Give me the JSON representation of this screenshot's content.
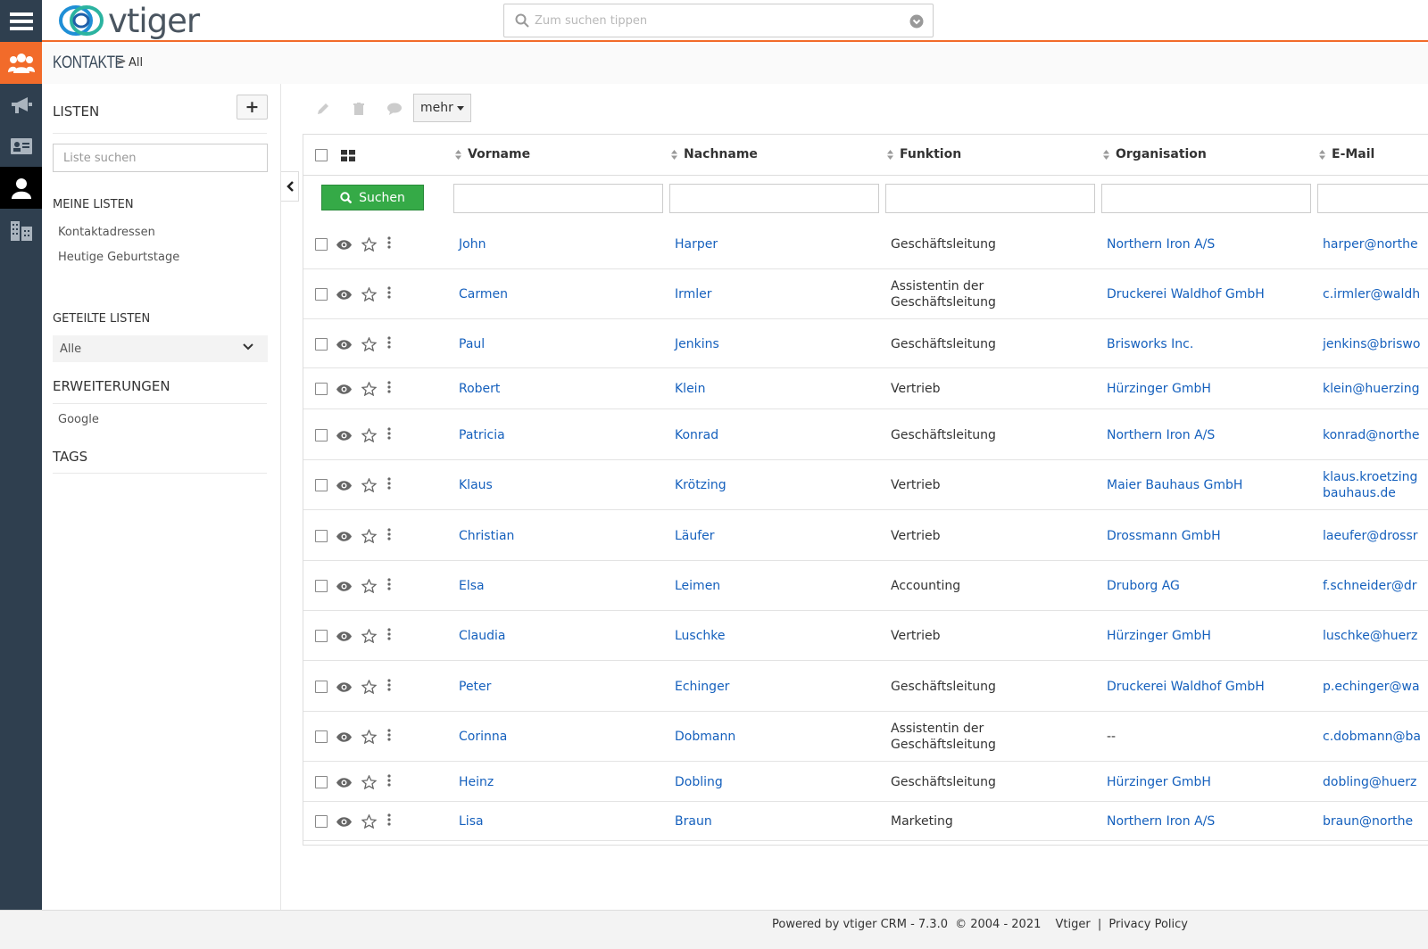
{
  "search": {
    "placeholder": "Zum suchen tippen"
  },
  "logo": {
    "text": "vtiger"
  },
  "breadcrumb": {
    "module": "KONTAKTE",
    "separator": ">",
    "view": "All"
  },
  "sidebar": {
    "lists_heading": "LISTEN",
    "add_label": "+",
    "list_search_placeholder": "Liste suchen",
    "my_lists_heading": "MEINE LISTEN",
    "my_lists": [
      "Kontaktadressen",
      "Heutige Geburtstage"
    ],
    "shared_lists_heading": "GETEILTE LISTEN",
    "shared_selected": "Alle",
    "extensions_heading": "ERWEITERUNGEN",
    "extensions": [
      "Google"
    ],
    "tags_heading": "TAGS"
  },
  "toolbar": {
    "more_label": "mehr"
  },
  "table": {
    "search_button": "Suchen",
    "columns": [
      "Vorname",
      "Nachname",
      "Funktion",
      "Organisation",
      "E-Mail"
    ],
    "rows": [
      {
        "first": "John",
        "last": "Harper",
        "func": [
          "Geschäftsleitung"
        ],
        "org": "Northern Iron A/S",
        "email": [
          "harper@northe"
        ]
      },
      {
        "first": "Carmen",
        "last": "Irmler",
        "func": [
          "Assistentin der",
          "Geschäftsleitung"
        ],
        "org": "Druckerei Waldhof GmbH",
        "email": [
          "c.irmler@waldh"
        ]
      },
      {
        "first": "Paul",
        "last": "Jenkins",
        "func": [
          "Geschäftsleitung"
        ],
        "org": "Brisworks Inc.",
        "email": [
          "jenkins@briswo"
        ]
      },
      {
        "first": "Robert",
        "last": "Klein",
        "func": [
          "Vertrieb"
        ],
        "org": "Hürzinger GmbH",
        "email": [
          "klein@huerzing"
        ]
      },
      {
        "first": "Patricia",
        "last": "Konrad",
        "func": [
          "Geschäftsleitung"
        ],
        "org": "Northern Iron A/S",
        "email": [
          "konrad@northe"
        ]
      },
      {
        "first": "Klaus",
        "last": "Krötzing",
        "func": [
          "Vertrieb"
        ],
        "org": "Maier Bauhaus GmbH",
        "email": [
          "klaus.kroetzing",
          "bauhaus.de"
        ]
      },
      {
        "first": "Christian",
        "last": "Läufer",
        "func": [
          "Vertrieb"
        ],
        "org": "Drossmann GmbH",
        "email": [
          "laeufer@drossr"
        ]
      },
      {
        "first": "Elsa",
        "last": "Leimen",
        "func": [
          "Accounting"
        ],
        "org": "Druborg AG",
        "email": [
          "f.schneider@dr"
        ]
      },
      {
        "first": "Claudia",
        "last": "Luschke",
        "func": [
          "Vertrieb"
        ],
        "org": "Hürzinger GmbH",
        "email": [
          "luschke@huerz"
        ]
      },
      {
        "first": "Peter",
        "last": "Echinger",
        "func": [
          "Geschäftsleitung"
        ],
        "org": "Druckerei Waldhof GmbH",
        "email": [
          "p.echinger@wa"
        ]
      },
      {
        "first": "Corinna",
        "last": "Dobmann",
        "func": [
          "Assistentin der",
          "Geschäftsleitung"
        ],
        "org": "--",
        "email": [
          "c.dobmann@ba"
        ]
      },
      {
        "first": "Heinz",
        "last": "Dobling",
        "func": [
          "Geschäftsleitung"
        ],
        "org": "Hürzinger GmbH",
        "email": [
          "dobling@huerz"
        ]
      },
      {
        "first": "Lisa",
        "last": "Braun",
        "func": [
          "Marketing"
        ],
        "org": "Northern Iron A/S",
        "email": [
          "braun@northe"
        ]
      }
    ]
  },
  "footer": {
    "powered": "Powered by vtiger CRM - 7.3.0",
    "copyright": "© 2004 - 2021",
    "vtiger_link": "Vtiger",
    "divider": "|",
    "privacy_link": "Privacy Policy"
  },
  "colors": {
    "accent": "#f26b2a",
    "rail": "#2f3f4f",
    "link": "#1560bd",
    "search_button": "#35aa47"
  }
}
